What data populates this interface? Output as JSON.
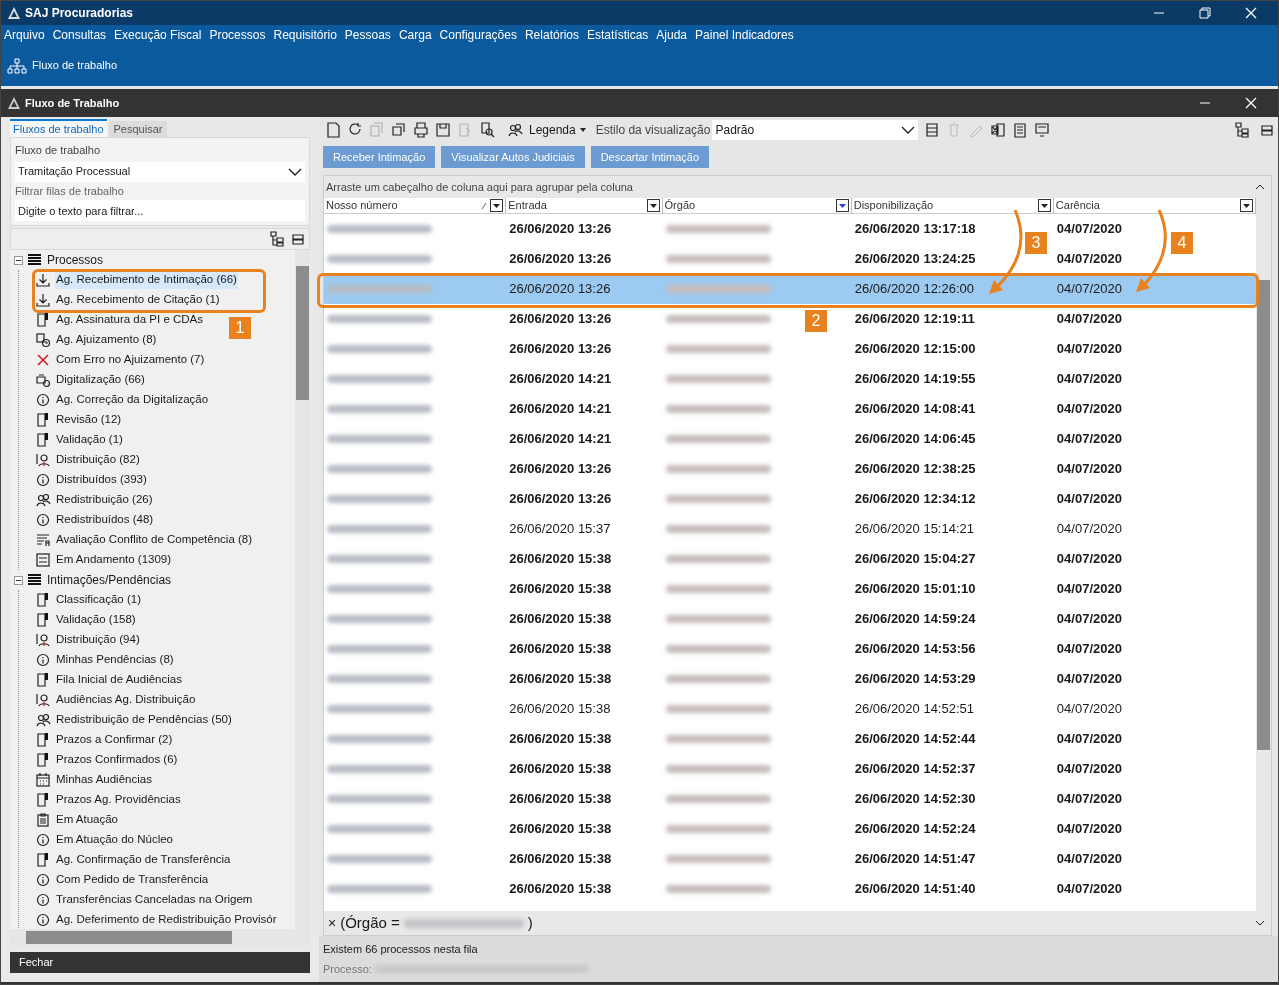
{
  "app_title": "SAJ Procuradorias",
  "menu": [
    "Arquivo",
    "Consultas",
    "Execução Fiscal",
    "Processos",
    "Requisitório",
    "Pessoas",
    "Carga",
    "Configurações",
    "Relatórios",
    "Estatísticas",
    "Ajuda",
    "Painel Indicadores"
  ],
  "ribbon": {
    "label": "Fluxo de trabalho"
  },
  "window": {
    "title": "Fluxo de Trabalho"
  },
  "left_tabs": [
    {
      "label": "Fluxos de trabalho",
      "selected": true
    },
    {
      "label": "Pesquisar",
      "selected": false
    }
  ],
  "workflow": {
    "label": "Fluxo de trabalho",
    "value": "Tramitação Processual"
  },
  "filter": {
    "label": "Filtrar filas de trabalho",
    "placeholder": "Digite o texto para filtrar..."
  },
  "tree": [
    {
      "label": "Processos",
      "kind": "stack",
      "expanded": true,
      "children": [
        {
          "label": "Ag. Recebimento de Intimação (66)",
          "kind": "download",
          "selected": true
        },
        {
          "label": "Ag. Recebimento de Citação (1)",
          "kind": "download",
          "selected": false
        },
        {
          "label": "Ag. Assinatura da PI e CDAs",
          "kind": "doc",
          "selected": false
        },
        {
          "label": "Ag. Ajuizamento (8)",
          "kind": "clock",
          "selected": false
        },
        {
          "label": "Com Erro no Ajuizamento (7)",
          "kind": "error",
          "selected": false
        },
        {
          "label": "Digitalização (66)",
          "kind": "scan",
          "selected": false
        },
        {
          "label": "Ag. Correção da Digitalização",
          "kind": "info",
          "selected": false
        },
        {
          "label": "Revisão (12)",
          "kind": "doc",
          "selected": false
        },
        {
          "label": "Validação (1)",
          "kind": "doc",
          "selected": false
        },
        {
          "label": "Distribuição (82)",
          "kind": "person",
          "selected": false
        },
        {
          "label": "Distribuídos (393)",
          "kind": "info",
          "selected": false
        },
        {
          "label": "Redistribuição (26)",
          "kind": "people",
          "selected": false
        },
        {
          "label": "Redistribuídos (48)",
          "kind": "info",
          "selected": false
        },
        {
          "label": "Avaliação Conflito de Competência (8)",
          "kind": "lines",
          "selected": false
        },
        {
          "label": "Em Andamento (1309)",
          "kind": "form",
          "selected": false
        }
      ]
    },
    {
      "label": "Intimações/Pendências",
      "kind": "stack",
      "expanded": true,
      "children": [
        {
          "label": "Classificação (1)",
          "kind": "doc",
          "selected": false
        },
        {
          "label": "Validação (158)",
          "kind": "doc",
          "selected": false
        },
        {
          "label": "Distribuição (94)",
          "kind": "person",
          "selected": false
        },
        {
          "label": "Minhas Pendências (8)",
          "kind": "info",
          "selected": false
        },
        {
          "label": "Fila Inicial de Audiências",
          "kind": "doc",
          "selected": false
        },
        {
          "label": "Audiências Ag. Distribuição",
          "kind": "person",
          "selected": false
        },
        {
          "label": "Redistribuição de Pendências (50)",
          "kind": "people",
          "selected": false
        },
        {
          "label": "Prazos a Confirmar (2)",
          "kind": "doc",
          "selected": false
        },
        {
          "label": "Prazos Confirmados (6)",
          "kind": "doc",
          "selected": false
        },
        {
          "label": "Minhas Audiências",
          "kind": "calendar",
          "selected": false
        },
        {
          "label": "Prazos Ag. Providências",
          "kind": "doc",
          "selected": false
        },
        {
          "label": "Em Atuação",
          "kind": "clipboard",
          "selected": false
        },
        {
          "label": "Em Atuação do Núcleo",
          "kind": "info",
          "selected": false
        },
        {
          "label": "Ag. Confirmação de Transferência",
          "kind": "doc",
          "selected": false
        },
        {
          "label": "Com Pedido de Transferência",
          "kind": "info",
          "selected": false
        },
        {
          "label": "Transferências Canceladas na Origem",
          "kind": "info",
          "selected": false
        },
        {
          "label": "Ag. Deferimento de Redistribuição Provisór",
          "kind": "info",
          "selected": false
        }
      ]
    }
  ],
  "close_button": "Fechar",
  "toolbar": {
    "legend": "Legenda",
    "style_label": "Estilo da visualização",
    "style_value": "Padrão"
  },
  "actions": [
    "Receber Intimação",
    "Visualizar Autos Judiciais",
    "Descartar Intimação"
  ],
  "group_hint": "Arraste um cabeçalho de coluna aqui para agrupar pela coluna",
  "columns": [
    "Nosso número",
    "Entrada",
    "Órgão",
    "Disponibilização",
    "Carência"
  ],
  "rows": [
    {
      "entrada": "26/06/2020 13:26",
      "disponibilizacao": "26/06/2020 13:17:18",
      "carencia": "04/07/2020",
      "unread": true,
      "selected": false
    },
    {
      "entrada": "26/06/2020 13:26",
      "disponibilizacao": "26/06/2020 13:24:25",
      "carencia": "04/07/2020",
      "unread": true,
      "selected": false
    },
    {
      "entrada": "26/06/2020 13:26",
      "disponibilizacao": "26/06/2020 12:26:00",
      "carencia": "04/07/2020",
      "unread": false,
      "selected": true
    },
    {
      "entrada": "26/06/2020 13:26",
      "disponibilizacao": "26/06/2020 12:19:11",
      "carencia": "04/07/2020",
      "unread": true,
      "selected": false
    },
    {
      "entrada": "26/06/2020 13:26",
      "disponibilizacao": "26/06/2020 12:15:00",
      "carencia": "04/07/2020",
      "unread": true,
      "selected": false
    },
    {
      "entrada": "26/06/2020 14:21",
      "disponibilizacao": "26/06/2020 14:19:55",
      "carencia": "04/07/2020",
      "unread": true,
      "selected": false
    },
    {
      "entrada": "26/06/2020 14:21",
      "disponibilizacao": "26/06/2020 14:08:41",
      "carencia": "04/07/2020",
      "unread": true,
      "selected": false
    },
    {
      "entrada": "26/06/2020 14:21",
      "disponibilizacao": "26/06/2020 14:06:45",
      "carencia": "04/07/2020",
      "unread": true,
      "selected": false
    },
    {
      "entrada": "26/06/2020 13:26",
      "disponibilizacao": "26/06/2020 12:38:25",
      "carencia": "04/07/2020",
      "unread": true,
      "selected": false
    },
    {
      "entrada": "26/06/2020 13:26",
      "disponibilizacao": "26/06/2020 12:34:12",
      "carencia": "04/07/2020",
      "unread": true,
      "selected": false
    },
    {
      "entrada": "26/06/2020 15:37",
      "disponibilizacao": "26/06/2020 15:14:21",
      "carencia": "04/07/2020",
      "unread": false,
      "selected": false
    },
    {
      "entrada": "26/06/2020 15:38",
      "disponibilizacao": "26/06/2020 15:04:27",
      "carencia": "04/07/2020",
      "unread": true,
      "selected": false
    },
    {
      "entrada": "26/06/2020 15:38",
      "disponibilizacao": "26/06/2020 15:01:10",
      "carencia": "04/07/2020",
      "unread": true,
      "selected": false
    },
    {
      "entrada": "26/06/2020 15:38",
      "disponibilizacao": "26/06/2020 14:59:24",
      "carencia": "04/07/2020",
      "unread": true,
      "selected": false
    },
    {
      "entrada": "26/06/2020 15:38",
      "disponibilizacao": "26/06/2020 14:53:56",
      "carencia": "04/07/2020",
      "unread": true,
      "selected": false
    },
    {
      "entrada": "26/06/2020 15:38",
      "disponibilizacao": "26/06/2020 14:53:29",
      "carencia": "04/07/2020",
      "unread": true,
      "selected": false
    },
    {
      "entrada": "26/06/2020 15:38",
      "disponibilizacao": "26/06/2020 14:52:51",
      "carencia": "04/07/2020",
      "unread": false,
      "selected": false
    },
    {
      "entrada": "26/06/2020 15:38",
      "disponibilizacao": "26/06/2020 14:52:44",
      "carencia": "04/07/2020",
      "unread": true,
      "selected": false
    },
    {
      "entrada": "26/06/2020 15:38",
      "disponibilizacao": "26/06/2020 14:52:37",
      "carencia": "04/07/2020",
      "unread": true,
      "selected": false
    },
    {
      "entrada": "26/06/2020 15:38",
      "disponibilizacao": "26/06/2020 14:52:30",
      "carencia": "04/07/2020",
      "unread": true,
      "selected": false
    },
    {
      "entrada": "26/06/2020 15:38",
      "disponibilizacao": "26/06/2020 14:52:24",
      "carencia": "04/07/2020",
      "unread": true,
      "selected": false
    },
    {
      "entrada": "26/06/2020 15:38",
      "disponibilizacao": "26/06/2020 14:51:47",
      "carencia": "04/07/2020",
      "unread": true,
      "selected": false
    },
    {
      "entrada": "26/06/2020 15:38",
      "disponibilizacao": "26/06/2020 14:51:40",
      "carencia": "04/07/2020",
      "unread": true,
      "selected": false
    }
  ],
  "filter_bar": {
    "close": "×",
    "text_start": "(Órgão =",
    "text_end": ")"
  },
  "status": {
    "count": "Existem 66 processos nesta fila",
    "process_label": "Processo:"
  },
  "annotations": [
    "1",
    "2",
    "3",
    "4"
  ]
}
